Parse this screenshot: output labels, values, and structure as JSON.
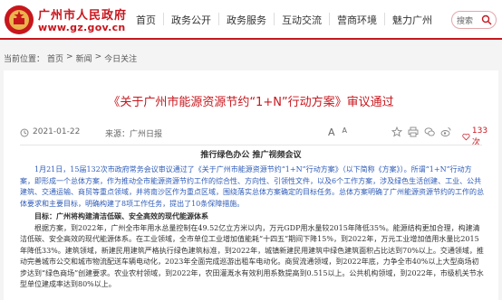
{
  "header": {
    "site_name": "广州市人民政府",
    "site_url": "www.gz.gov.cn",
    "nav": [
      "首页",
      "政务公开",
      "政务服务",
      "互动交流",
      "营商环境",
      "魅力广州"
    ],
    "search_label": "搜索"
  },
  "breadcrumb": {
    "prefix": "当前位置：",
    "items": [
      "首页",
      "新闻",
      "今日关注"
    ],
    "sep": ">"
  },
  "article": {
    "title": "《关于广州市能源资源节约“1+N”行动方案》审议通过",
    "date": "2021-01-22",
    "source_label": "来源：",
    "source": "广州日报",
    "font_controls": [
      "A",
      "A"
    ],
    "likes": "133次",
    "subhead": "推行绿色办公 推广视频会议",
    "para1_a": "1月21日，15届132次市政府常务会议审议通过了《关于广州市能源资源节约“1+N”行动方案》（以下简称《方案》）。所谓“1+N”行动方案，即形成一个总体方案，作为推动全市能源资源节约工作的综合性、方向性、引领性文件，以及6个工作方案，涉及绿色生活创建、工业、公共建筑、交通运输、商贸等重点领域，并将南沙区作为重点区域，围绕落实总体方案确定的目标任务。总体方案明确了广州能源资源节约的工作的总体要求和主要目标，明确构建了8项工作任务，提出了10条保障措施。",
    "section1": "目标：广州将构建清洁低碳、安全高效的现代能源体系",
    "para2": "根据方案，到2022年，广州全市年用水总量控制在49.52亿立方米以内，万元GDP用水量较2015年降低35%。能源结构更加合理，构建清洁低碳、安全高效的现代能源体系。在工业领域，全市单位工业增加值能耗“十四五”期间下降15%，到2022年，万元工业增加值用水量比2015年降低33%。建筑领域，新建民用建筑严格执行绿色建筑标准，到2022年，城镇新建民用建筑中绿色建筑面积占比达到70%以上。交通领域，推动完善城市公交和城市物流配送车辆电动化，2023年全面完成巡游出租车电动化。商贸流通领域，到2022年底，力争全市40%以上大型商场初步达到“绿色商场”创建要求。农业农村领域，到2022年，农田灌溉水有效利用系数提高到0.515以上。公共机构领域，到2022年，市级机关节水型单位建成率达到80%以上。"
  },
  "colors": {
    "brand_red": "#c8161d",
    "link_blue": "#2f5cb8"
  }
}
